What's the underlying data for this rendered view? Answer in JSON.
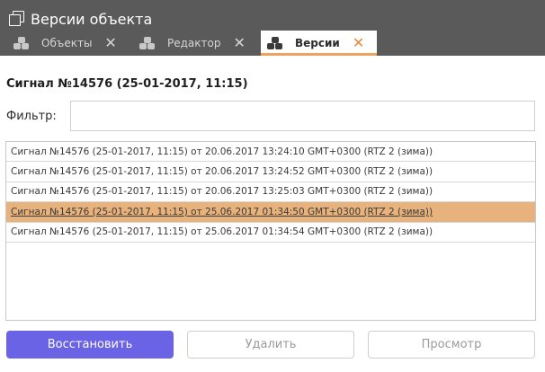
{
  "window": {
    "title": "Версии объекта",
    "title_icon": "copy-icon"
  },
  "tabs": [
    {
      "label": "Объекты",
      "icon": "cubes-icon",
      "close": "✕",
      "active": false
    },
    {
      "label": "Редактор",
      "icon": "cubes-icon",
      "close": "✕",
      "active": false
    },
    {
      "label": "Версии",
      "icon": "cubes-icon",
      "close": "✕",
      "active": true
    }
  ],
  "main": {
    "heading": "Сигнал №14576 (25-01-2017, 11:15)",
    "filter": {
      "label": "Фильтр:",
      "value": "",
      "placeholder": ""
    },
    "versions": [
      "Сигнал №14576 (25-01-2017, 11:15) от 20.06.2017 13:24:10 GMT+0300 (RTZ 2 (зима))",
      "Сигнал №14576 (25-01-2017, 11:15) от 20.06.2017 13:24:52 GMT+0300 (RTZ 2 (зима))",
      "Сигнал №14576 (25-01-2017, 11:15) от 20.06.2017 13:25:03 GMT+0300 (RTZ 2 (зима))",
      "Сигнал №14576 (25-01-2017, 11:15) от 25.06.2017 01:34:50 GMT+0300 (RTZ 2 (зима))",
      "Сигнал №14576 (25-01-2017, 11:15) от 25.06.2017 01:34:54 GMT+0300 (RTZ 2 (зима))"
    ],
    "selected_index": 3
  },
  "buttons": {
    "restore": "Восстановить",
    "delete": "Удалить",
    "view": "Просмотр"
  },
  "colors": {
    "header_bg": "#5a5a5a",
    "active_tab_accent": "#f0a35c",
    "selected_row": "#e8b27c",
    "primary_button": "#6b63e6"
  }
}
